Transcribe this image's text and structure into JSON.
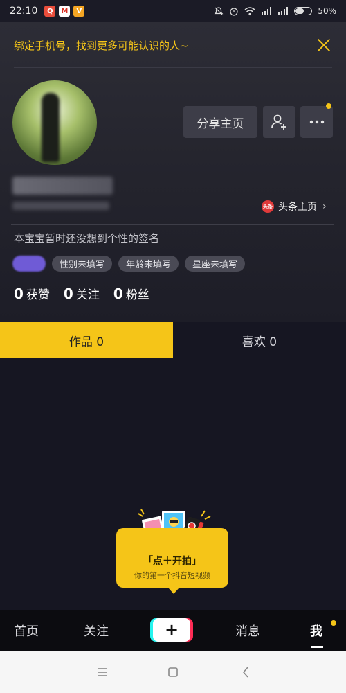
{
  "status_bar": {
    "time": "22:10",
    "battery_percent": "50%",
    "battery_level": 0.5
  },
  "banner": {
    "text": "绑定手机号，找到更多可能认识的人~",
    "close_icon": "close-icon"
  },
  "profile": {
    "share_button": "分享主页",
    "toutiao_link": "头条主页",
    "toutiao_logo": "头条",
    "bio": "本宝宝暂时还没想到个性的签名",
    "tags": [
      "性别未填写",
      "年龄未填写",
      "星座未填写"
    ],
    "stats": [
      {
        "num": "0",
        "label": "获赞"
      },
      {
        "num": "0",
        "label": "关注"
      },
      {
        "num": "0",
        "label": "粉丝"
      }
    ]
  },
  "tabs": [
    {
      "label": "作品 0",
      "active": true
    },
    {
      "label": "喜欢 0",
      "active": false
    }
  ],
  "empty_state": {
    "title": "「点＋开拍」",
    "subtitle": "你的第一个抖音短视频"
  },
  "bottom_nav": {
    "items": [
      "首页",
      "关注",
      "消息",
      "我"
    ],
    "plus": "+"
  },
  "colors": {
    "accent": "#f5c518",
    "background": "#161622",
    "button_bg": "#3d3d48"
  }
}
